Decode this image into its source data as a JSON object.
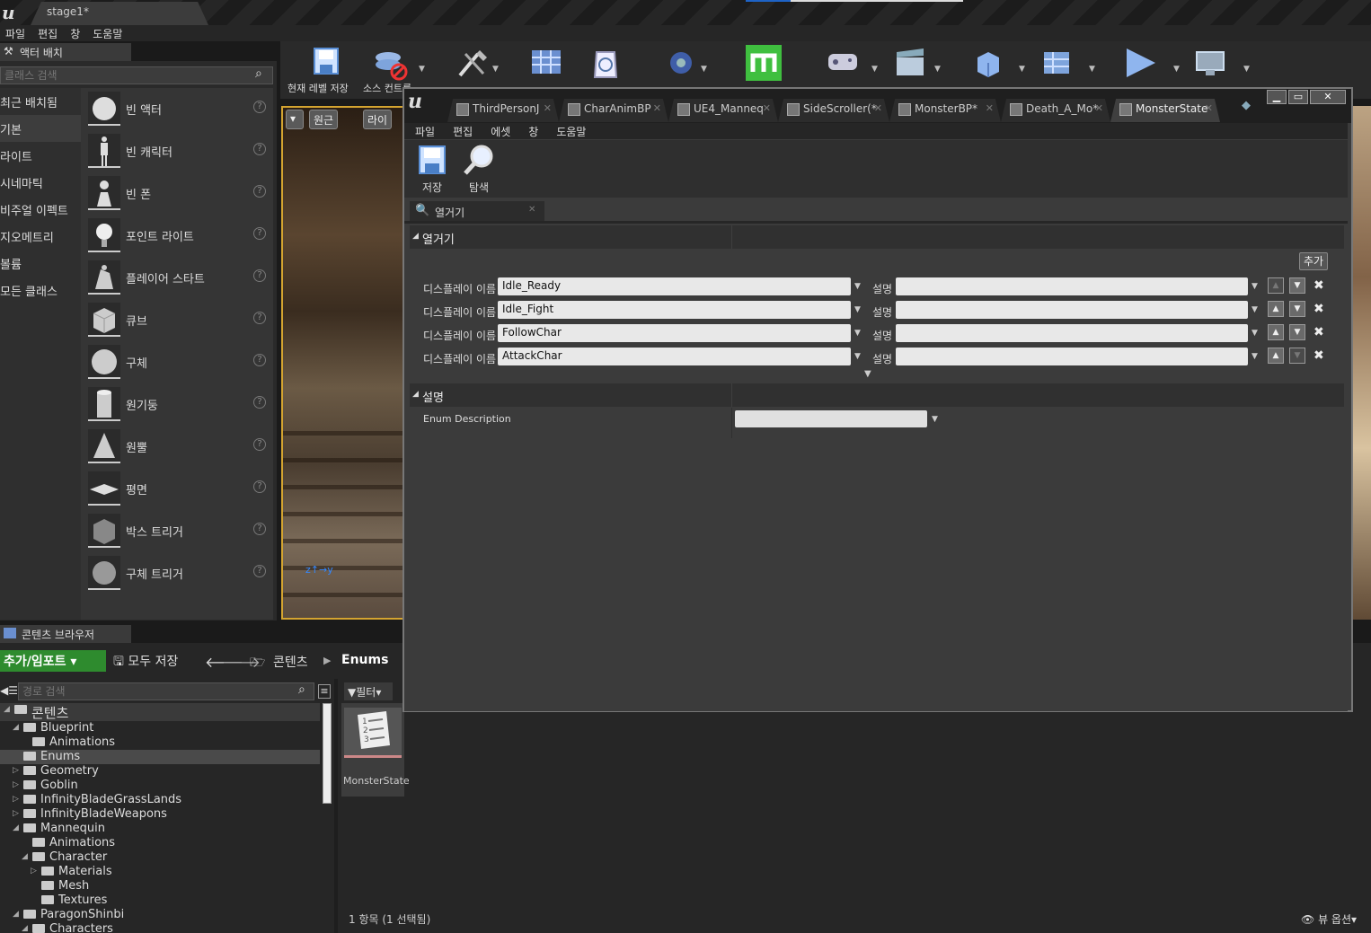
{
  "window": {
    "tab_title": "stage1*"
  },
  "menu": [
    "파일",
    "편집",
    "창",
    "도움말"
  ],
  "place_actors": {
    "tab_label": "액터 배치",
    "search_placeholder": "클래스 검색",
    "categories": [
      "최근 배치됨",
      "기본",
      "라이트",
      "시네마틱",
      "비주얼 이펙트",
      "지오메트리",
      "볼륨",
      "모든 클래스"
    ],
    "selected_category": "기본",
    "items": [
      {
        "label": "빈 액터",
        "icon": "sphere-icon"
      },
      {
        "label": "빈 캐릭터",
        "icon": "character-icon"
      },
      {
        "label": "빈 폰",
        "icon": "pawn-icon"
      },
      {
        "label": "포인트 라이트",
        "icon": "lightbulb-icon"
      },
      {
        "label": "플레이어 스타트",
        "icon": "player-start-icon"
      },
      {
        "label": "큐브",
        "icon": "cube-icon"
      },
      {
        "label": "구체",
        "icon": "sphere-icon"
      },
      {
        "label": "원기둥",
        "icon": "cylinder-icon"
      },
      {
        "label": "원뿔",
        "icon": "cone-icon"
      },
      {
        "label": "평면",
        "icon": "plane-icon"
      },
      {
        "label": "박스 트리거",
        "icon": "box-trigger-icon"
      },
      {
        "label": "구체 트리거",
        "icon": "sphere-trigger-icon"
      }
    ],
    "help_glyph": "?"
  },
  "toolbar": {
    "save_level": "현재 레벨 저장",
    "source_control": "소스 컨트롤"
  },
  "viewport": {
    "perspective": "원근",
    "lit": "라이"
  },
  "content_browser": {
    "tab_label": "콘텐츠 브라우저",
    "add_import": "추가/임포트",
    "save_all": "모두 저장",
    "crumb_root": "콘텐츠",
    "crumb_current": "Enums",
    "path_search_placeholder": "경로 검색",
    "filter": "필터",
    "tree": [
      {
        "label": "콘텐츠",
        "depth": 0,
        "expanded": true,
        "root": true
      },
      {
        "label": "Blueprint",
        "depth": 1,
        "expanded": true
      },
      {
        "label": "Animations",
        "depth": 2
      },
      {
        "label": "Enums",
        "depth": 1,
        "selected": true
      },
      {
        "label": "Geometry",
        "depth": 1,
        "collapsed": true
      },
      {
        "label": "Goblin",
        "depth": 1,
        "collapsed": true
      },
      {
        "label": "InfinityBladeGrassLands",
        "depth": 1,
        "collapsed": true
      },
      {
        "label": "InfinityBladeWeapons",
        "depth": 1,
        "collapsed": true
      },
      {
        "label": "Mannequin",
        "depth": 1,
        "expanded": true
      },
      {
        "label": "Animations",
        "depth": 2
      },
      {
        "label": "Character",
        "depth": 2,
        "expanded": true
      },
      {
        "label": "Materials",
        "depth": 3,
        "collapsed": true
      },
      {
        "label": "Mesh",
        "depth": 3
      },
      {
        "label": "Textures",
        "depth": 3
      },
      {
        "label": "ParagonShinbi",
        "depth": 1,
        "expanded": true
      },
      {
        "label": "Characters",
        "depth": 2,
        "expanded": true
      }
    ],
    "asset_name": "MonsterState",
    "item_count": "1 항목 (1 선택됨)",
    "view_options": "뷰 옵션"
  },
  "enum_editor": {
    "tabs": [
      {
        "label": "ThirdPersonJ",
        "active": false
      },
      {
        "label": "CharAnimBP",
        "active": false
      },
      {
        "label": "UE4_Manneq",
        "active": false
      },
      {
        "label": "SideScroller(*",
        "active": false
      },
      {
        "label": "MonsterBP*",
        "active": false
      },
      {
        "label": "Death_A_Mo*",
        "active": false
      },
      {
        "label": "MonsterState",
        "active": true
      }
    ],
    "menu": [
      "파일",
      "편집",
      "에셋",
      "창",
      "도움말"
    ],
    "save_label": "저장",
    "browse_label": "탐색",
    "panel_tab": "열거기",
    "section_enumerators": "열거기",
    "add_label": "추가",
    "display_name_label": "디스플레이 이름",
    "description_label": "설명",
    "enumerators": [
      "Idle_Ready",
      "Idle_Fight",
      "FollowChar",
      "AttackChar"
    ],
    "section_description": "설명",
    "enum_description_label": "Enum Description"
  }
}
